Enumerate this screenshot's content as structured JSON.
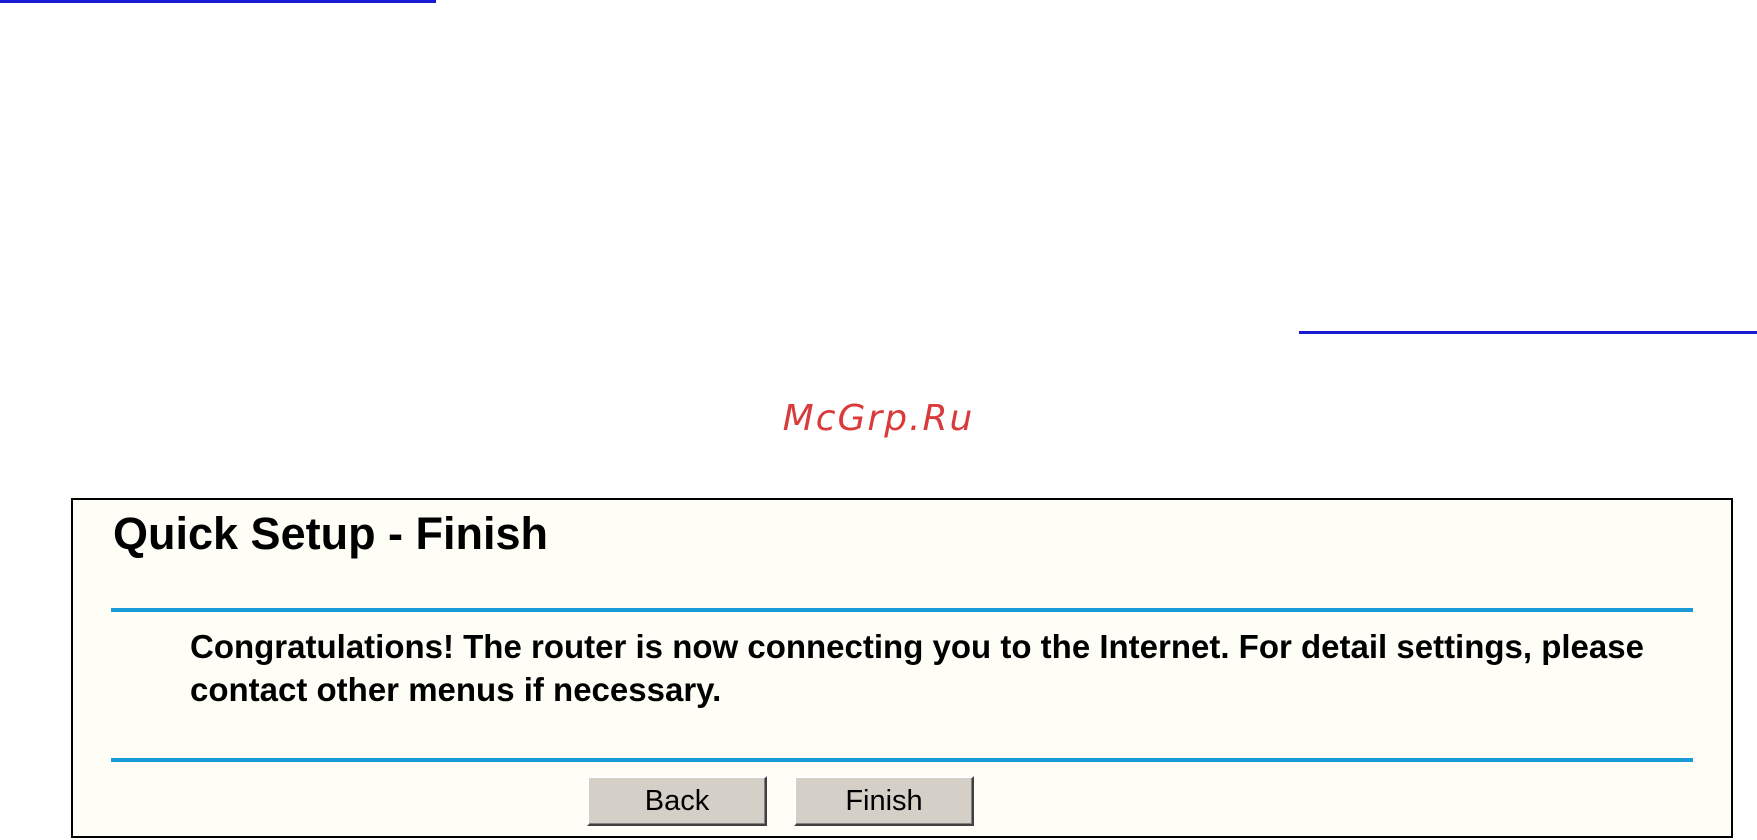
{
  "watermark": "McGrp.Ru",
  "panel": {
    "title": "Quick Setup - Finish",
    "message": "Congratulations! The router is now connecting you to the Internet. For detail settings, please contact other menus if necessary.",
    "buttons": {
      "back_label": "Back",
      "finish_label": "Finish"
    }
  },
  "colors": {
    "panel_background": "#fefef6",
    "separator": "#1a9ad6",
    "watermark": "#d93b3b",
    "link_rule": "#1a1ad6"
  }
}
